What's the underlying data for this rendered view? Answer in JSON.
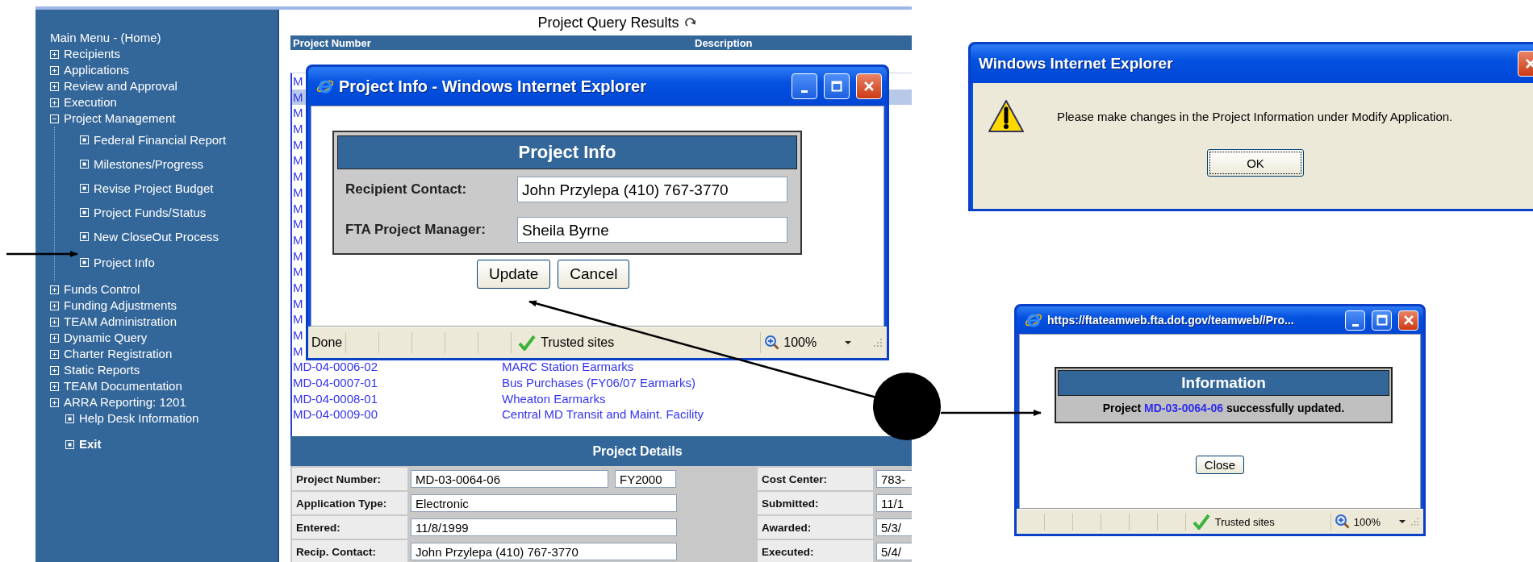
{
  "sidebar": {
    "title": "Main Menu - (Home)",
    "items": [
      {
        "label": "Recipients",
        "kind": "folder",
        "expanded": false,
        "bold": false
      },
      {
        "label": "Applications",
        "kind": "folder",
        "expanded": false,
        "bold": false
      },
      {
        "label": "Review and Approval",
        "kind": "folder",
        "expanded": false,
        "bold": false
      },
      {
        "label": "Execution",
        "kind": "folder",
        "expanded": false,
        "bold": false
      },
      {
        "label": "Project Management",
        "kind": "folder",
        "expanded": true,
        "bold": false,
        "children": [
          {
            "label": "Federal Financial Report"
          },
          {
            "label": "Milestones/Progress"
          },
          {
            "label": "Revise Project Budget"
          },
          {
            "label": "Project Funds/Status"
          },
          {
            "label": "New CloseOut Process"
          },
          {
            "label": "Project Info"
          }
        ]
      },
      {
        "label": "Funds Control",
        "kind": "folder",
        "expanded": false,
        "bold": false
      },
      {
        "label": "Funding Adjustments",
        "kind": "folder",
        "expanded": false,
        "bold": false
      },
      {
        "label": "TEAM Administration",
        "kind": "folder",
        "expanded": false,
        "bold": false
      },
      {
        "label": "Dynamic Query",
        "kind": "folder",
        "expanded": false,
        "bold": false
      },
      {
        "label": "Charter Registration",
        "kind": "folder",
        "expanded": false,
        "bold": false
      },
      {
        "label": "Static Reports",
        "kind": "folder",
        "expanded": false,
        "bold": false
      },
      {
        "label": "TEAM Documentation",
        "kind": "folder",
        "expanded": false,
        "bold": false
      },
      {
        "label": "ARRA Reporting: 1201",
        "kind": "folder",
        "expanded": false,
        "bold": false
      },
      {
        "label": "Help Desk Information",
        "kind": "leaf",
        "bold": false
      },
      {
        "label": "Exit",
        "kind": "leaf",
        "bold": true
      }
    ]
  },
  "results": {
    "title": "Project Query Results",
    "columns": [
      "Project Number",
      "Description"
    ],
    "rows": [
      {
        "number": "M",
        "selected": false
      },
      {
        "number": "M",
        "selected": true
      },
      {
        "number": "M",
        "selected": false
      },
      {
        "number": "M",
        "selected": false
      },
      {
        "number": "M",
        "selected": false
      },
      {
        "number": "M",
        "selected": false
      },
      {
        "number": "M",
        "selected": false
      },
      {
        "number": "M",
        "selected": false
      },
      {
        "number": "M",
        "selected": false
      },
      {
        "number": "M",
        "selected": false
      },
      {
        "number": "M",
        "selected": false
      },
      {
        "number": "M",
        "selected": false
      },
      {
        "number": "M",
        "selected": false
      },
      {
        "number": "M",
        "selected": false
      },
      {
        "number": "M",
        "selected": false
      },
      {
        "number": "M",
        "selected": false
      },
      {
        "number": "M",
        "selected": false
      },
      {
        "number": "M",
        "selected": false
      },
      {
        "number": "MD-04-0006-02",
        "description": "MARC Station Earmarks",
        "selected": false
      },
      {
        "number": "MD-04-0007-01",
        "description": "Bus Purchases (FY06/07 Earmarks)",
        "selected": false
      },
      {
        "number": "MD-04-0008-01",
        "description": "Wheaton Earmarks",
        "selected": false
      },
      {
        "number": "MD-04-0009-00",
        "description": "Central MD Transit and Maint. Facility",
        "selected": false
      }
    ]
  },
  "details": {
    "title": "Project Details",
    "rows": [
      {
        "label": "Project Number:",
        "values": [
          "MD-03-0064-06",
          "FY2000"
        ],
        "right_label": "Cost Center:",
        "right_value": "783-"
      },
      {
        "label": "Application Type:",
        "values": [
          "Electronic"
        ],
        "right_label": "Submitted:",
        "right_value": "11/1"
      },
      {
        "label": "Entered:",
        "values": [
          "11/8/1999"
        ],
        "right_label": "Awarded:",
        "right_value": "5/3/"
      },
      {
        "label": "Recip. Contact:",
        "values": [
          "John Przylepa (410) 767-3770"
        ],
        "right_label": "Executed:",
        "right_value": "5/4/"
      }
    ]
  },
  "project_info_window": {
    "title": "Project Info - Windows Internet Explorer",
    "panel_title": "Project Info",
    "fields": [
      {
        "label": "Recipient Contact:",
        "value": "John Przylepa (410) 767-3770"
      },
      {
        "label": "FTA Project Manager:",
        "value": "Sheila Byrne"
      }
    ],
    "buttons": [
      "Update",
      "Cancel"
    ],
    "status_bar": {
      "text": "Done",
      "zone": "Trusted sites",
      "zoom": "100%"
    }
  },
  "alert": {
    "title": "Windows Internet Explorer",
    "message": "Please make changes in the Project Information under Modify Application.",
    "buttons": [
      "OK"
    ]
  },
  "info_window": {
    "title": "https://ftateamweb.fta.dot.gov/teamweb//Pro...",
    "panel_title": "Information",
    "message": {
      "before": "Project ",
      "link": "MD-03-0064-06",
      "after": " successfully updated."
    },
    "buttons": [
      "Close"
    ],
    "status_bar": {
      "zone": "Trusted sites",
      "zoom": "100%"
    }
  }
}
